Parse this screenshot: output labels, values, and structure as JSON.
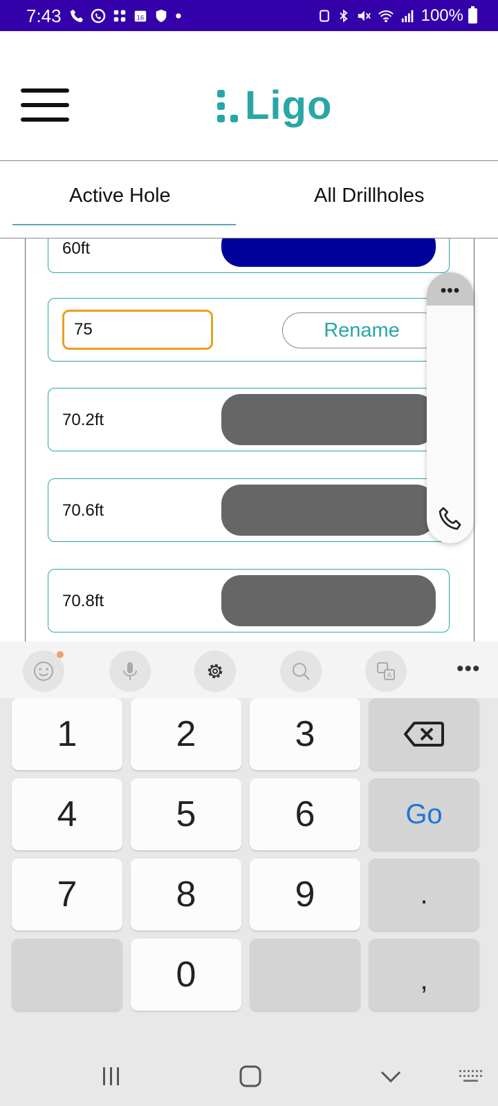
{
  "status_bar": {
    "time": "7:43",
    "battery": "100%"
  },
  "header": {
    "logo_text": "Ligo"
  },
  "tabs": [
    {
      "label": "Active Hole",
      "active": true
    },
    {
      "label": "All Drillholes",
      "active": false
    }
  ],
  "rows": [
    {
      "depth": "60ft",
      "bar_color": "#00009a"
    },
    {
      "input_value": "75",
      "button_label": "Rename"
    },
    {
      "depth": "70.2ft",
      "bar_color": "#666666"
    },
    {
      "depth": "70.6ft",
      "bar_color": "#666666"
    },
    {
      "depth": "70.8ft",
      "bar_color": "#666666"
    }
  ],
  "keyboard": {
    "keys": [
      "1",
      "2",
      "3",
      "4",
      "5",
      "6",
      "Go",
      "7",
      "8",
      "9",
      ".",
      "0",
      ","
    ]
  },
  "colors": {
    "brand": "#2aa6a6",
    "status_bar": "#3300aa",
    "input_focus": "#e8a020",
    "go_key": "#1a78d8"
  },
  "icons": [
    "hamburger-menu-icon",
    "emoji-icon",
    "microphone-icon",
    "settings-icon",
    "search-icon",
    "translate-icon",
    "more-icon",
    "backspace-icon",
    "phone-icon",
    "recents-icon",
    "home-icon",
    "back-icon",
    "keyboard-icon"
  ]
}
